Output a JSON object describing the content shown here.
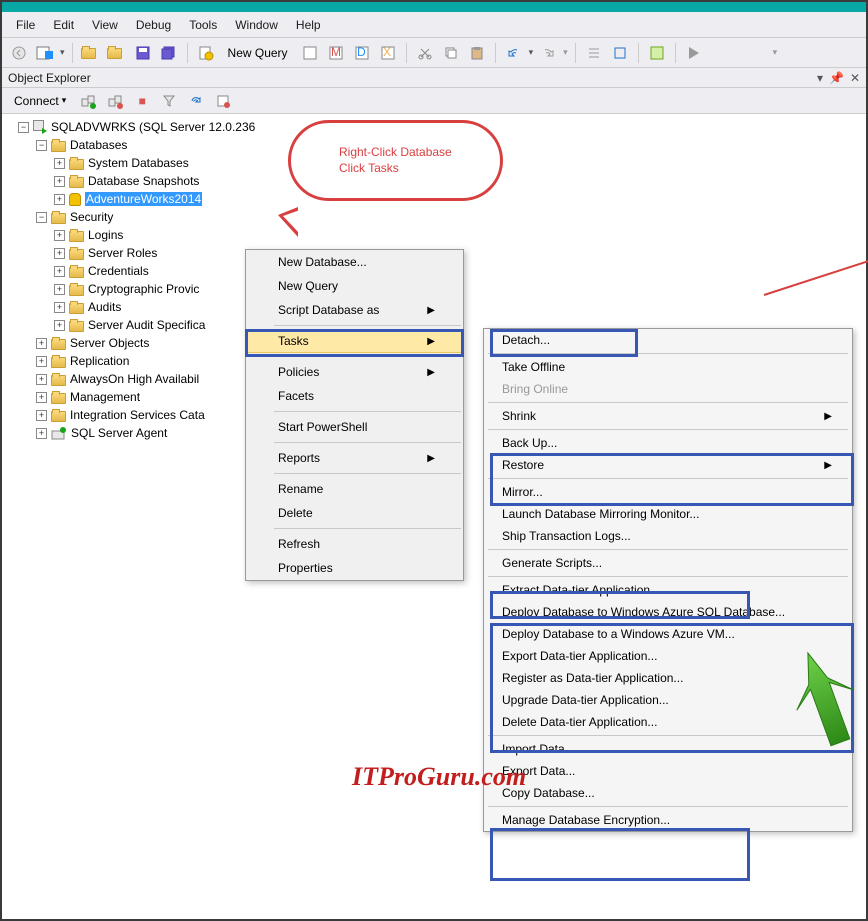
{
  "menubar": [
    "File",
    "Edit",
    "View",
    "Debug",
    "Tools",
    "Window",
    "Help"
  ],
  "toolbar": {
    "new_query": "New Query"
  },
  "panel": {
    "title": "Object Explorer",
    "connect": "Connect"
  },
  "tree": {
    "server": "SQLADVWRKS (SQL Server 12.0.236",
    "databases": "Databases",
    "sysdb": "System Databases",
    "dbsnap": "Database Snapshots",
    "aw": "AdventureWorks2014",
    "security": "Security",
    "logins": "Logins",
    "serverroles": "Server Roles",
    "credentials": "Credentials",
    "crypto": "Cryptographic Provic",
    "audits": "Audits",
    "sas": "Server Audit Specifica",
    "serverobj": "Server Objects",
    "replication": "Replication",
    "aoha": "AlwaysOn High Availabil",
    "mgmt": "Management",
    "isc": "Integration Services Cata",
    "agent": "SQL Server Agent"
  },
  "context": {
    "newdb": "New Database...",
    "newquery": "New Query",
    "script": "Script Database as",
    "tasks": "Tasks",
    "policies": "Policies",
    "facets": "Facets",
    "powershell": "Start PowerShell",
    "reports": "Reports",
    "rename": "Rename",
    "delete": "Delete",
    "refresh": "Refresh",
    "properties": "Properties"
  },
  "tasks": {
    "detach": "Detach...",
    "offline": "Take Offline",
    "online": "Bring Online",
    "shrink": "Shrink",
    "backup": "Back Up...",
    "restore": "Restore",
    "mirror": "Mirror...",
    "launchmirror": "Launch Database Mirroring Monitor...",
    "shiplogs": "Ship Transaction Logs...",
    "genscripts": "Generate Scripts...",
    "extract": "Extract Data-tier Application...",
    "deployazure": "Deploy Database to Windows Azure SQL Database...",
    "deployvm": "Deploy Database to a Windows Azure VM...",
    "exportdac": "Export Data-tier Application...",
    "registerdac": "Register as Data-tier Application...",
    "upgradedac": "Upgrade Data-tier Application...",
    "deletedac": "Delete Data-tier Application...",
    "importdata": "Import Data...",
    "exportdata": "Export Data...",
    "copydb": "Copy Database...",
    "managede": "Manage Database Encryption..."
  },
  "callout": {
    "line1": "Right-Click Database",
    "line2": "Click Tasks"
  },
  "watermark": "ITProGuru.com"
}
